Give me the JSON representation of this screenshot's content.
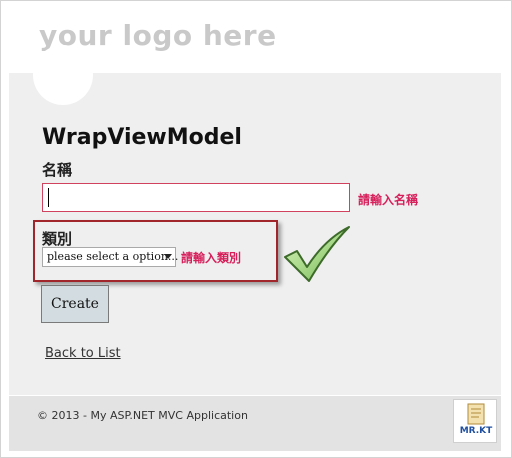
{
  "header": {
    "logo_text": "your logo here"
  },
  "form": {
    "title": "WrapViewModel",
    "name_label": "名稱",
    "name_value": "",
    "name_error": "請輸入名稱",
    "category_label": "類別",
    "category_selected": "please select a option...",
    "category_error": "請輸入類別",
    "create_label": "Create",
    "back_label": "Back to List"
  },
  "footer": {
    "copyright": "© 2013 - My ASP.NET MVC Application",
    "badge_text": "MR.KT"
  },
  "colors": {
    "error": "#d61f5b",
    "highlight_border": "#a0262b",
    "button_bg": "#d3dce0"
  }
}
